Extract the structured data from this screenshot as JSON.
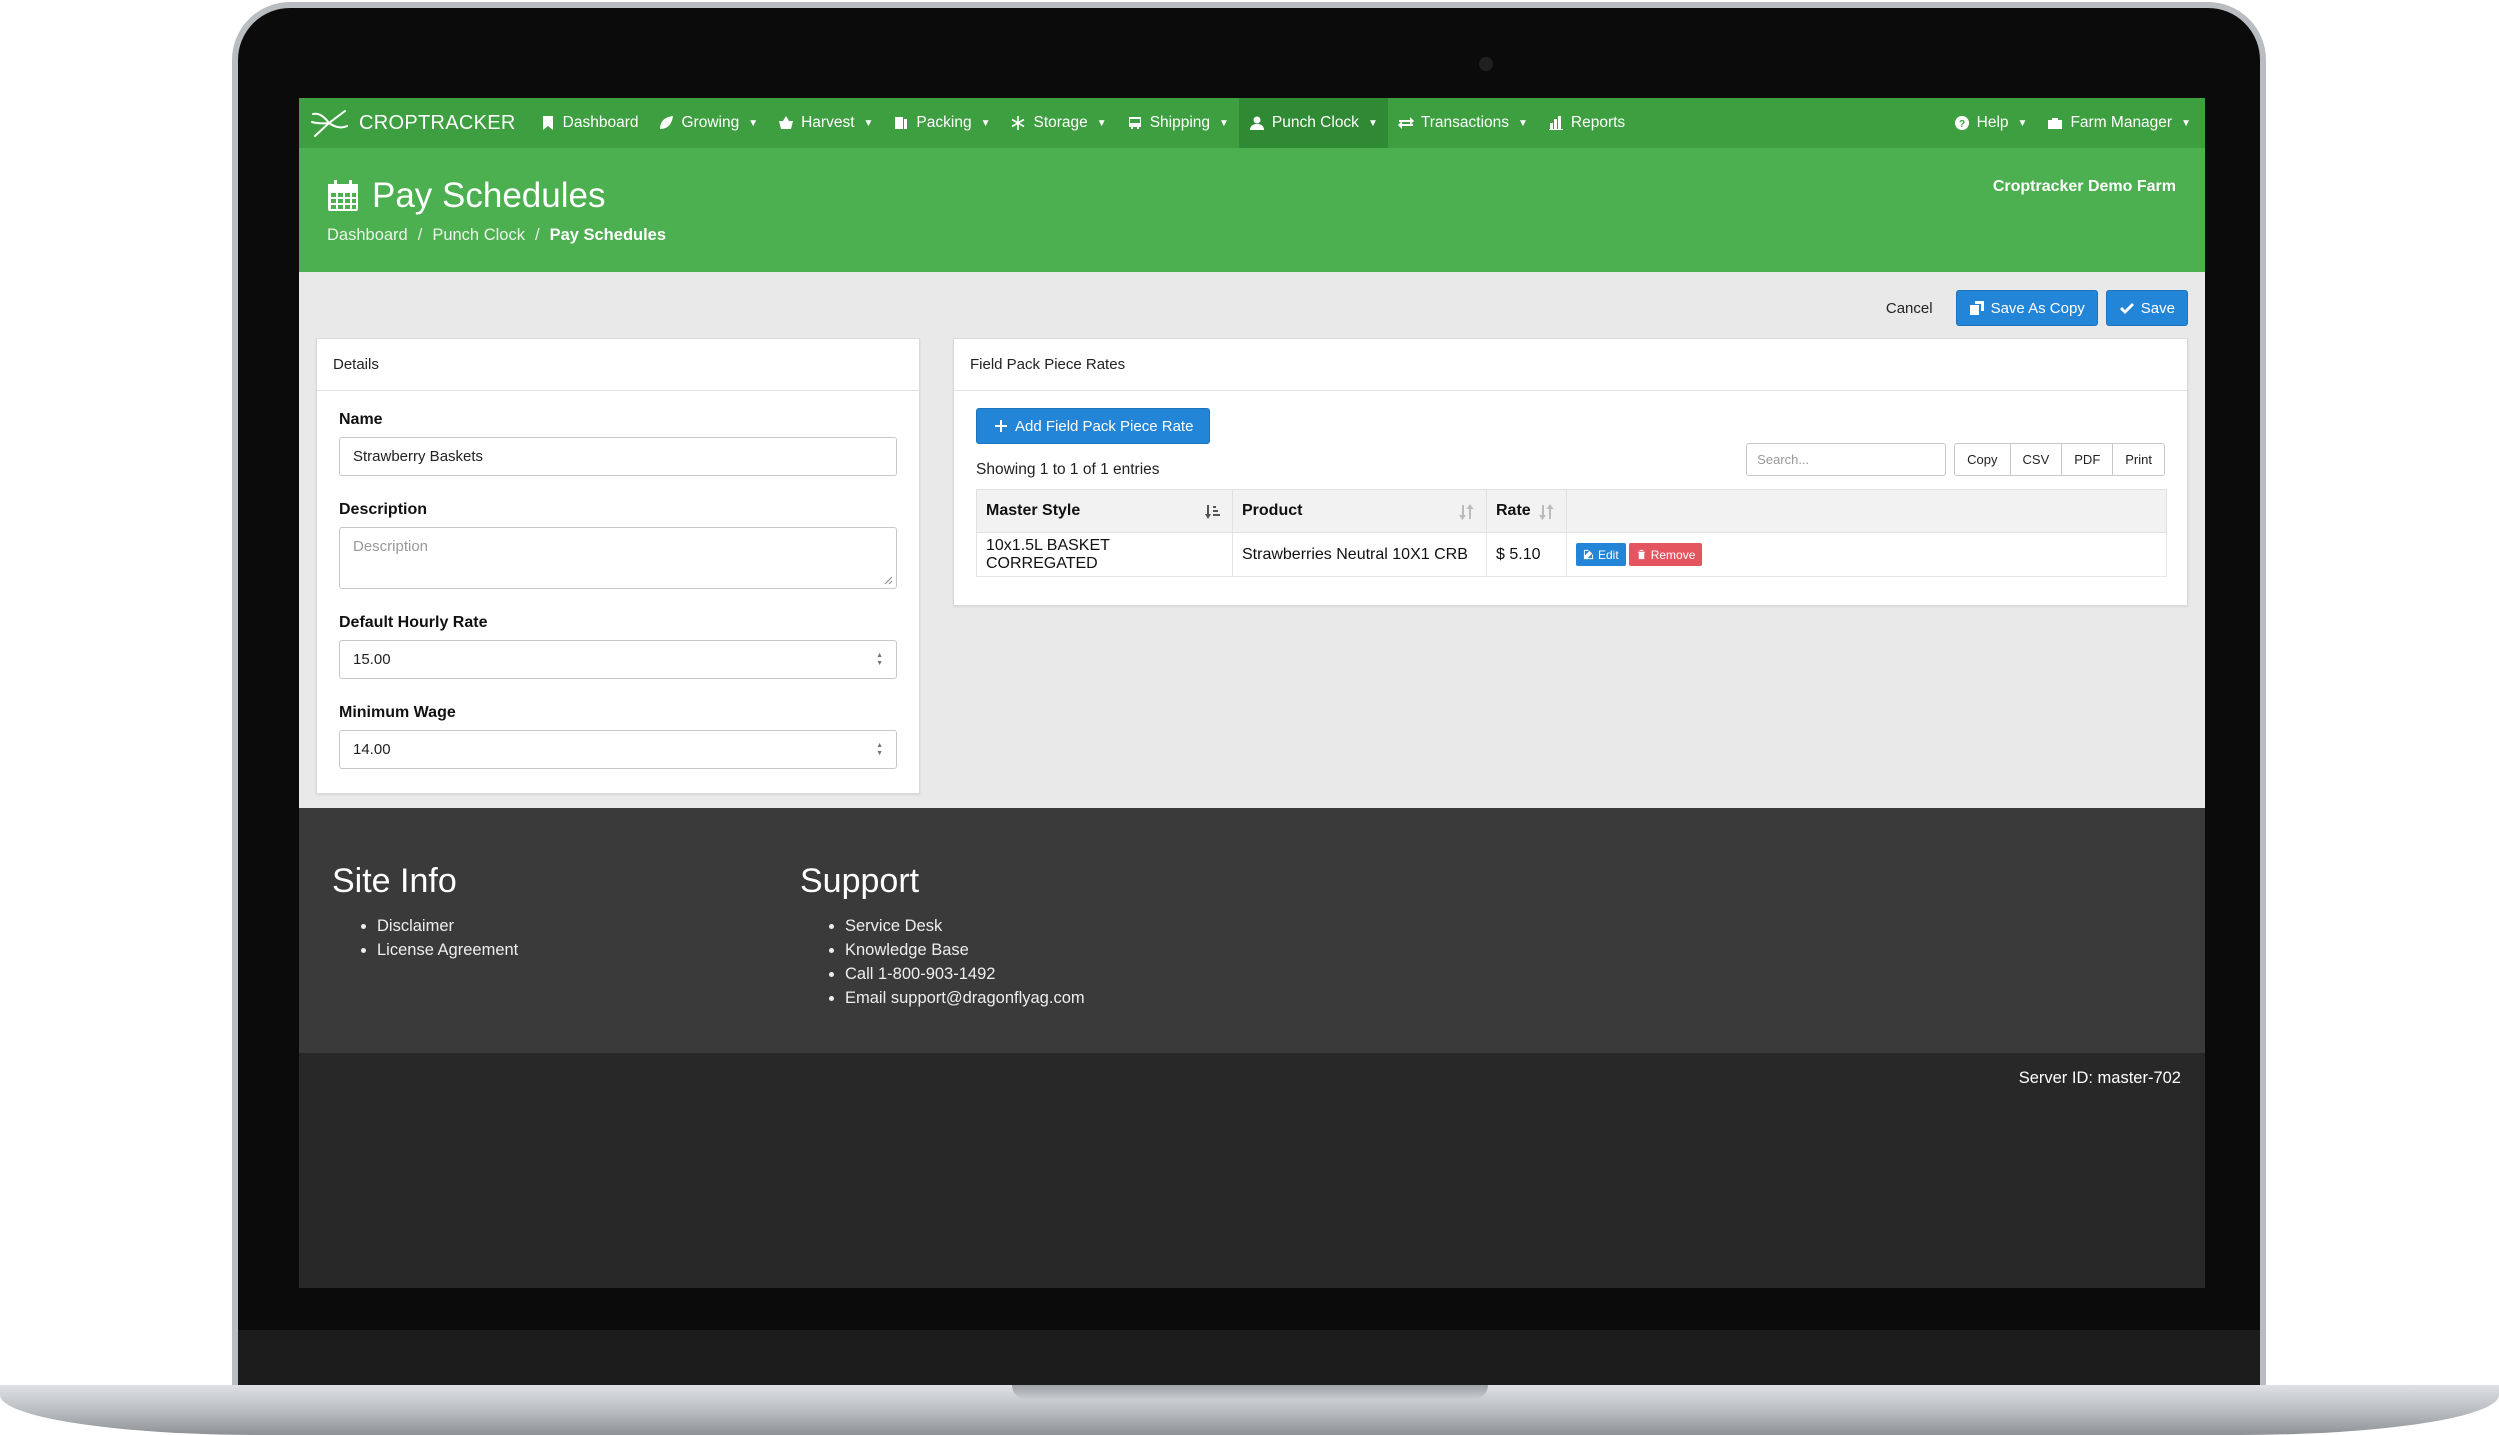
{
  "app": {
    "brand": "CROPTRACKER",
    "farm_name": "Croptracker Demo Farm"
  },
  "nav": {
    "items": [
      {
        "label": "Dashboard",
        "icon": "bookmark-icon",
        "dropdown": false
      },
      {
        "label": "Growing",
        "icon": "leaf-icon",
        "dropdown": true
      },
      {
        "label": "Harvest",
        "icon": "basket-icon",
        "dropdown": true
      },
      {
        "label": "Packing",
        "icon": "boxes-icon",
        "dropdown": true
      },
      {
        "label": "Storage",
        "icon": "snowflake-icon",
        "dropdown": true
      },
      {
        "label": "Shipping",
        "icon": "bus-icon",
        "dropdown": true
      },
      {
        "label": "Punch Clock",
        "icon": "user-icon",
        "dropdown": true,
        "active": true
      },
      {
        "label": "Transactions",
        "icon": "exchange-icon",
        "dropdown": true
      },
      {
        "label": "Reports",
        "icon": "bar-chart-icon",
        "dropdown": false
      }
    ],
    "right": [
      {
        "label": "Help",
        "icon": "question-circle-icon"
      },
      {
        "label": "Farm Manager",
        "icon": "briefcase-icon"
      }
    ]
  },
  "header": {
    "title": "Pay Schedules",
    "breadcrumb": [
      "Dashboard",
      "Punch Clock",
      "Pay Schedules"
    ]
  },
  "toolbar": {
    "cancel_label": "Cancel",
    "save_copy_label": "Save As Copy",
    "save_label": "Save"
  },
  "details": {
    "heading": "Details",
    "name_label": "Name",
    "name_value": "Strawberry Baskets",
    "description_label": "Description",
    "description_placeholder": "Description",
    "hourly_label": "Default Hourly Rate",
    "hourly_value": "15.00",
    "min_wage_label": "Minimum Wage",
    "min_wage_value": "14.00"
  },
  "rates": {
    "heading": "Field Pack Piece Rates",
    "add_label": "Add Field Pack Piece Rate",
    "showing": "Showing 1 to 1 of 1 entries",
    "search_placeholder": "Search...",
    "export_buttons": [
      "Copy",
      "CSV",
      "PDF",
      "Print"
    ],
    "columns": [
      "Master Style",
      "Product",
      "Rate",
      ""
    ],
    "rows": [
      {
        "master_style": "10x1.5L BASKET CORREGATED",
        "product": "Strawberries Neutral 10X1 CRB",
        "rate": "$ 5.10"
      }
    ],
    "edit_label": "Edit",
    "remove_label": "Remove"
  },
  "footer": {
    "site_info_title": "Site Info",
    "site_info_links": [
      "Disclaimer",
      "License Agreement"
    ],
    "support_title": "Support",
    "support_links": [
      "Service Desk",
      "Knowledge Base",
      "Call 1-800-903-1492",
      "Email support@dragonflyag.com"
    ],
    "server_id": "Server ID: master-702"
  },
  "colors": {
    "nav_green": "#3d9f40",
    "header_green": "#4caf50",
    "primary_blue": "#2385d8",
    "danger_red": "#e55560",
    "footer_dark": "#3a3a3a"
  }
}
